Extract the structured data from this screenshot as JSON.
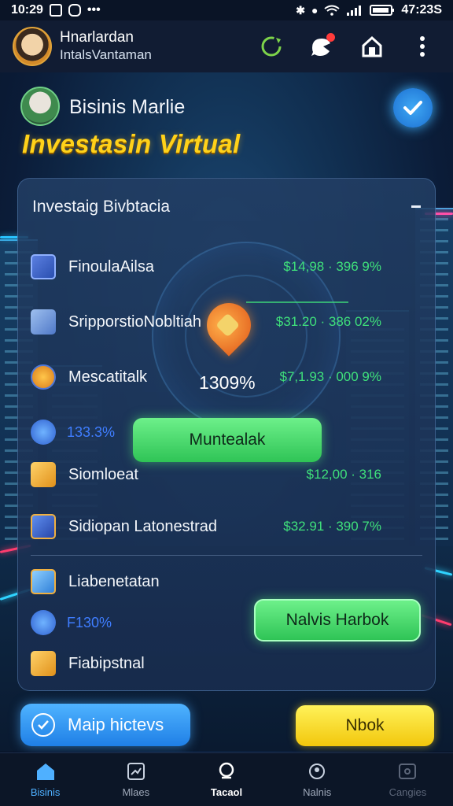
{
  "status_bar": {
    "time": "10:29",
    "dots": "•••",
    "right_time": "47:23S"
  },
  "app_bar": {
    "title": "Hnarlardan",
    "subtitle": "IntalsVantaman"
  },
  "header": {
    "profile_name": "Bisinis Marlie",
    "hero_title": "Investasin Virtual"
  },
  "panel": {
    "title": "Investaig Bivbtacia",
    "rows": [
      {
        "name": "FinoulaAilsa",
        "value": "$14,98 · 396 9%",
        "icon_color": "#5b7fe0"
      },
      {
        "name": "SripporstioNobltiah",
        "value": "$31.20 · 386 02%",
        "icon_color": "#7aa0d8"
      },
      {
        "name": "Mescatitalk",
        "value": "$7,1.93 · 000 9%",
        "icon_color": "#e0a03a"
      },
      {
        "name": "Siomloeat",
        "value": "$12,00 · 316",
        "icon_color": "#f2a93a"
      },
      {
        "name": "Sidiopan Latonestrad",
        "value": "$32.91 · 390 7%",
        "icon_color": "#3a6fd8"
      },
      {
        "name": "Liabenetatan",
        "icon_color": "#4fb3ff"
      },
      {
        "name": "Fiabipstnal",
        "icon_color": "#f2a93a"
      }
    ],
    "blue_value_1": "133.3%",
    "blue_value_2": "F130%",
    "center_percent": "1309%",
    "primary_button": "Muntealak",
    "secondary_button": "Nalvis Harbok"
  },
  "bottom_buttons": {
    "blue": "Maip hictevs",
    "yellow": "Nbok"
  },
  "nav": [
    {
      "label": "Bisinis",
      "icon": "home-icon"
    },
    {
      "label": "Mlaes",
      "icon": "chart-icon"
    },
    {
      "label": "Tacaol",
      "icon": "tag-icon"
    },
    {
      "label": "Nalnis",
      "icon": "user-icon"
    },
    {
      "label": "Cangies",
      "icon": "settings-icon"
    }
  ],
  "colors": {
    "accent_green": "#3fe07b",
    "accent_blue": "#3f7dff",
    "hero_yellow": "#ffd21a"
  }
}
